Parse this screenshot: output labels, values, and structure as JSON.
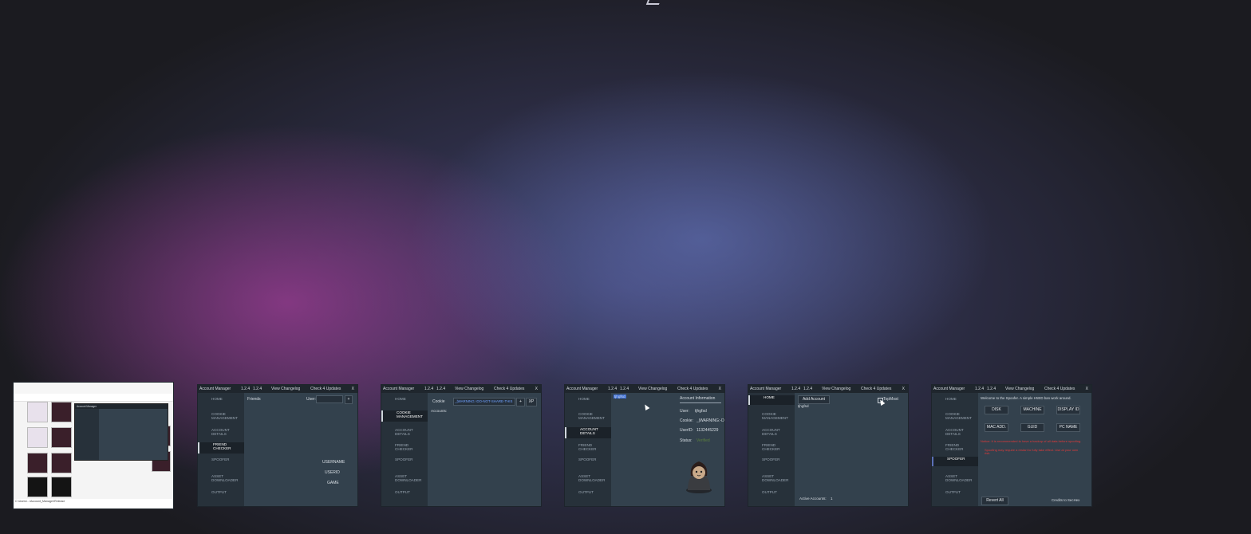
{
  "desktop": {
    "accent_pink": "#a83a95",
    "accent_blue": "#5b6fb6"
  },
  "app": {
    "title": "Account Manager",
    "version_a": "1.2.4",
    "version_b": "1.2.4",
    "changelog": "View Changelog",
    "updates": "Check 4 Updates",
    "close": "X",
    "nav": {
      "home": "HOME",
      "cookie": "COOKIE MANAGEMENT",
      "account": "ACCOUNT DETAILS",
      "friend": "FRIEND CHECKER",
      "spoofer": "SPOOFER",
      "asset": "ASSET DOWNLOADER",
      "output": "OUTPUT"
    }
  },
  "thumb1": {
    "status_text": "C:\\Users\\...\\Account_Manager\\Release",
    "item_selected": "Account Manager"
  },
  "thumb2": {
    "friends_label": "Friends",
    "user_label": "User:",
    "add_btn": "+",
    "col_username": "USERNAME",
    "col_userid": "USERID",
    "col_game": "GAME"
  },
  "thumb3": {
    "cookie_label": "Cookie",
    "cookie_value": "_|WARNING:-DO-NOT-SHARE-THIS",
    "add_btn": "+",
    "xp_btn": "XP",
    "accounts_label": "Accounts:"
  },
  "thumb4": {
    "selected_account": "tjhgfsd",
    "info_title": "Account Information",
    "user_label": "User:",
    "user_value": "tjhgfsd",
    "cookie_label": "Cookie:",
    "cookie_value": "_|WARNING:-D",
    "userid_label": "UserID:",
    "userid_value": "1132445229",
    "status_label": "Status:",
    "status_value": "Verified"
  },
  "thumb5": {
    "add_account": "Add Account",
    "account": "tjhgfsd",
    "topmost": "TopMost",
    "active_label": "Active Accounts:",
    "active_count": "1"
  },
  "thumb6": {
    "welcome": "Welcome to the Spoofer. A simple HWID ban work around.",
    "buttons": [
      "DISK",
      "MACHINE",
      "DISPLAY ID",
      "MAC ADD.",
      "GUID",
      "PC NAME"
    ],
    "warning_1": "Notice: It is recommended to have a backup of all data before spoofing.",
    "warning_2": "Spoofing may require a restart to fully take effect. Use at your own risk.",
    "revert": "Revert All",
    "credits": "Credits to SecHex"
  }
}
